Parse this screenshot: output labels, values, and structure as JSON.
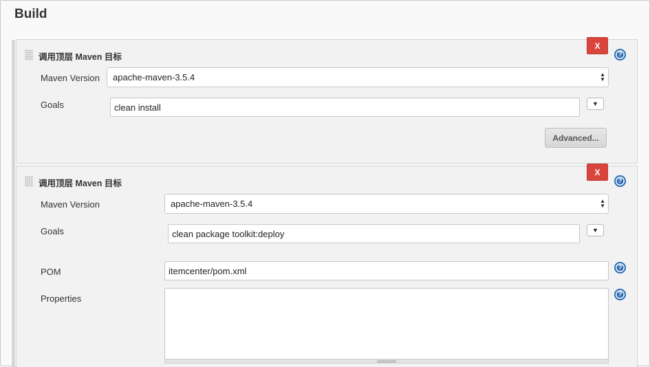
{
  "section": {
    "title": "Build"
  },
  "steps": [
    {
      "title": "调用顶层 Maven 目标",
      "delete_label": "X",
      "help_icon": "?",
      "maven_version_label": "Maven Version",
      "maven_version_value": "apache-maven-3.5.4",
      "goals_label": "Goals",
      "goals_value": "clean install",
      "advanced_label": "Advanced..."
    },
    {
      "title": "调用顶层 Maven 目标",
      "delete_label": "X",
      "help_icon": "?",
      "maven_version_label": "Maven Version",
      "maven_version_value": "apache-maven-3.5.4",
      "goals_label": "Goals",
      "goals_value": "clean package toolkit:deploy",
      "pom_label": "POM",
      "pom_value": "itemcenter/pom.xml",
      "properties_label": "Properties",
      "properties_value": ""
    }
  ],
  "icons": {
    "dropdown": "▼",
    "select_up": "▲",
    "select_down": "▼"
  },
  "colors": {
    "delete_button": "#d9453d",
    "help_icon": "#2e6fb5"
  }
}
